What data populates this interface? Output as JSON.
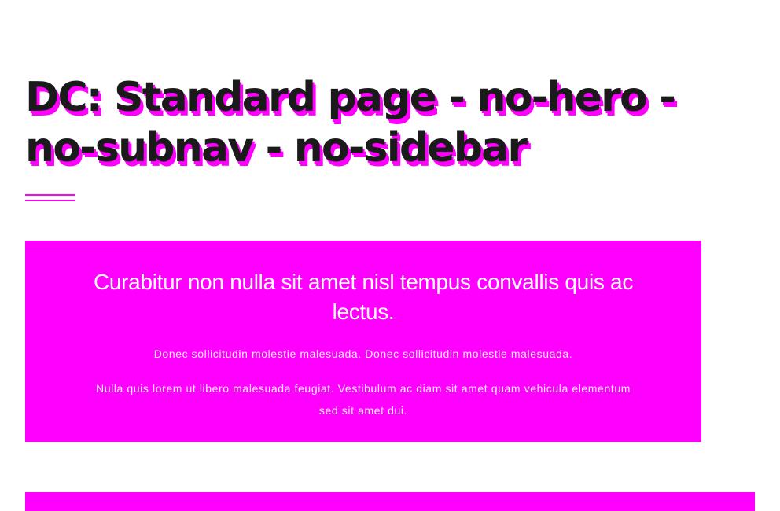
{
  "page": {
    "title": "DC: Standard page - no-hero - no-subnav - no-sidebar"
  },
  "callout": {
    "heading": "Curabitur non nulla sit amet nisl tempus convallis quis ac lectus.",
    "paragraphs": [
      "Donec sollicitudin molestie malesuada. Donec sollicitudin molestie malesuada.",
      "Nulla quis lorem ut libero malesuada feugiat. Vestibulum ac diam sit amet quam vehicula elementum sed sit amet dui."
    ]
  },
  "colors": {
    "accent": "#ff00ff",
    "title_text": "#1a1a1a",
    "callout_text": "#ffffff",
    "background": "#ffffff"
  }
}
